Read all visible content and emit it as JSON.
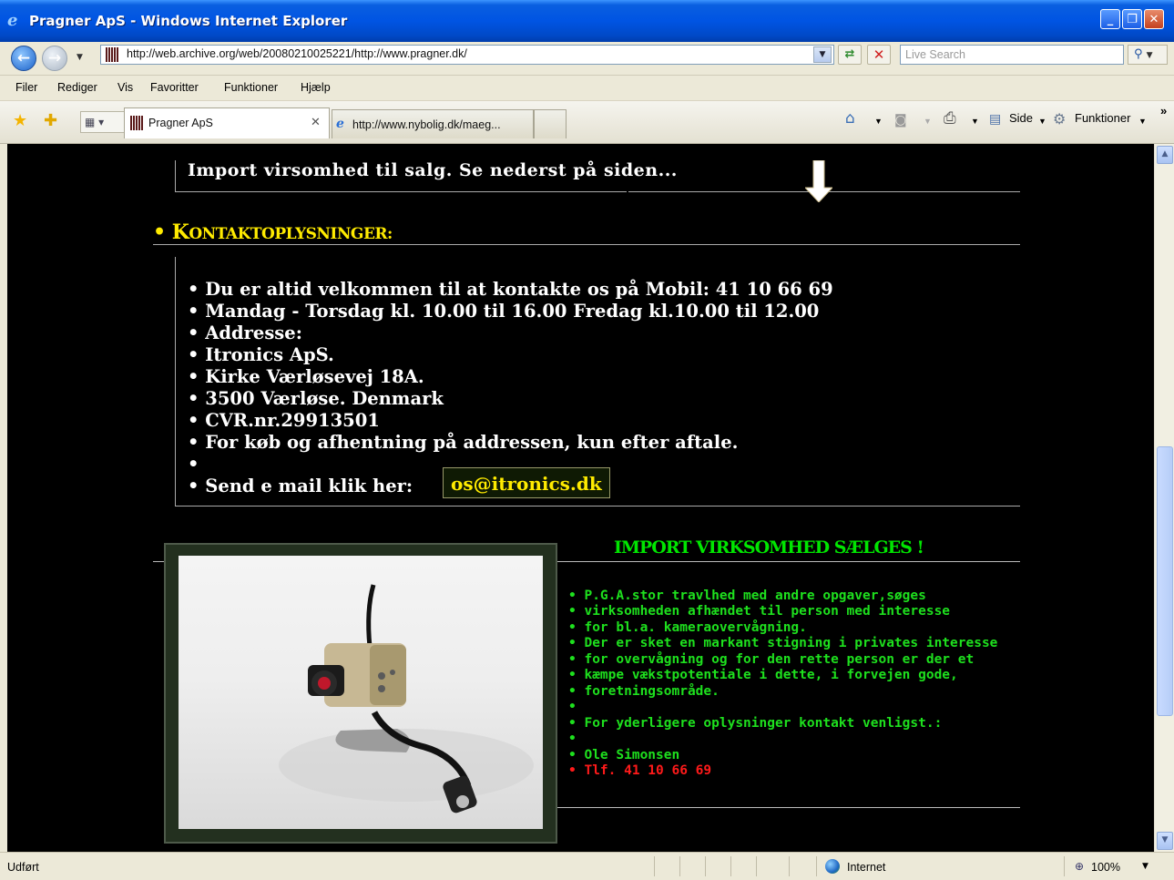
{
  "window": {
    "title": "Pragner ApS - Windows Internet Explorer",
    "buttons": {
      "minimize": "_",
      "maximize": "❐",
      "close": "✕"
    }
  },
  "address_bar": {
    "url": "http://web.archive.org/web/20080210025221/http://www.pragner.dk/",
    "search_placeholder": "Live Search"
  },
  "menu": [
    "Filer",
    "Rediger",
    "Vis",
    "Favoritter",
    "Funktioner",
    "Hjælp"
  ],
  "tabs": [
    {
      "label": "Pragner ApS",
      "active": true
    },
    {
      "label": "http://www.nybolig.dk/maeg...",
      "active": false
    }
  ],
  "command_bar": {
    "page_label": "Side",
    "tools_label": "Funktioner",
    "overflow": "»"
  },
  "page": {
    "import_note": "Import virsomhed til salg. Se nederst på siden...",
    "section_heading": "• Kontaktoplysninger:",
    "contact_lines": [
      "• Du er altid velkommen til at kontakte os på Mobil: 41 10 66 69",
      "• Mandag - Torsdag kl. 10.00 til 16.00 Fredag kl.10.00 til 12.00",
      "• Addresse:",
      "• Itronics ApS.",
      "• Kirke Værløsevej 18A.",
      "• 3500 Værløse. Denmark",
      "• CVR.nr.29913501",
      "• For køb og afhentning på addressen, kun efter aftale.",
      "•",
      "• Send e mail klik her:"
    ],
    "email": "os@itronics.dk",
    "sale_heading": "IMPORT VIRKSOMHED SÆLGES !",
    "sale_lines": [
      "• P.G.A.stor travlhed med andre opgaver,søges",
      "• virksomheden afhændet til person med interesse",
      "• for bl.a. kameraovervågning.",
      "• Der er sket en markant stigning i privates interesse",
      "• for overvågning og for den rette person er der et",
      "• kæmpe vækstpotentiale i dette, i forvejen gode,",
      "• foretningsområde.",
      "•",
      "• For yderligere oplysninger kontakt venligst.:",
      "•",
      "• Ole Simonsen",
      "• Tlf. 41 10 66 69"
    ]
  },
  "status_bar": {
    "status": "Udført",
    "zone": "Internet",
    "zoom": "100%"
  },
  "colors": {
    "heading_yellow": "#ffeb00",
    "sale_green": "#1ee01e",
    "phone_red": "#ff1a1a",
    "page_bg": "#000000"
  }
}
